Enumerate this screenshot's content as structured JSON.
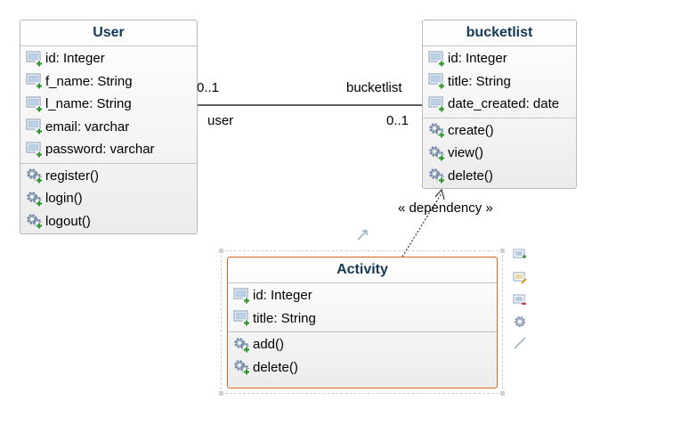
{
  "classes": {
    "user": {
      "title": "User",
      "attributes": [
        "id: Integer",
        "f_name: String",
        "l_name: String",
        "email: varchar",
        "password: varchar"
      ],
      "operations": [
        "register()",
        "login()",
        "logout()"
      ]
    },
    "bucketlist": {
      "title": "bucketlist",
      "attributes": [
        "id: Integer",
        "title: String",
        "date_created: date"
      ],
      "operations": [
        "create()",
        "view()",
        "delete()"
      ]
    },
    "activity": {
      "title": "Activity",
      "attributes": [
        "id: Integer",
        "title: String"
      ],
      "operations": [
        "add()",
        "delete()"
      ]
    }
  },
  "association": {
    "left_multiplicity": "0..1",
    "left_role": "user",
    "right_role": "bucketlist",
    "right_multiplicity": "0..1"
  },
  "dependency_label": "« dependency »",
  "icons": {
    "attribute": "attribute-field-icon",
    "operation": "operation-gear-icon"
  },
  "colors": {
    "title_text": "#143a58",
    "selection_border": "#d9651f",
    "attribute_plus": "#2e9a2e"
  }
}
